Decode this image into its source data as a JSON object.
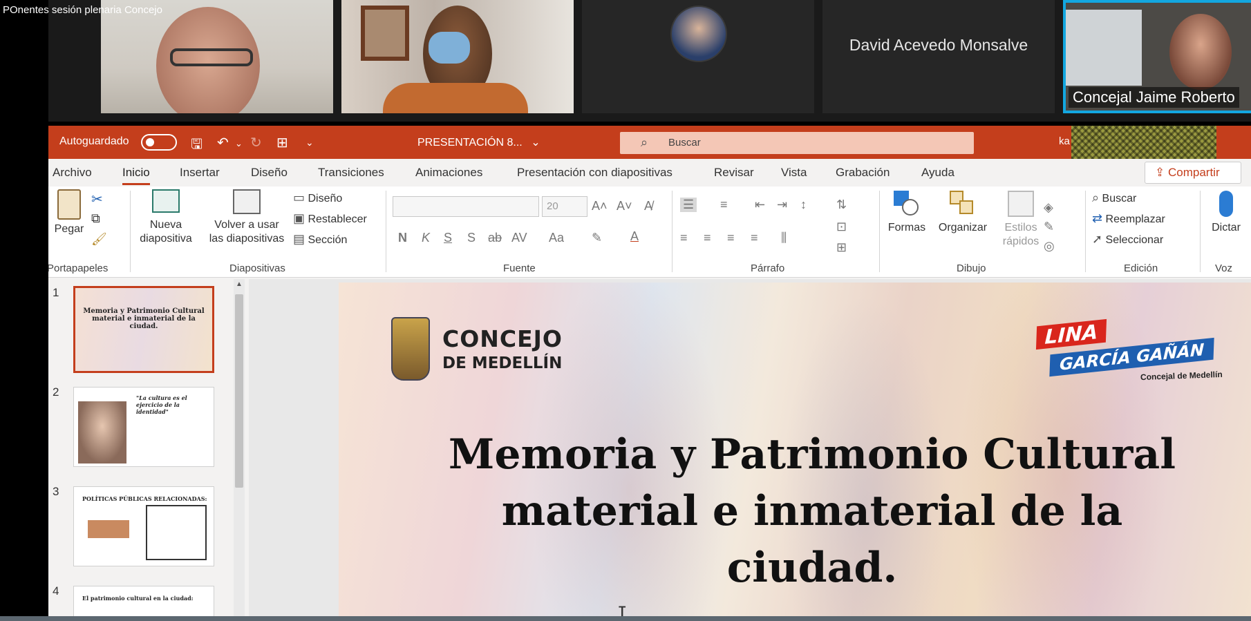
{
  "window": {
    "title": "POnentes sesión plenaria Concejo"
  },
  "participants": [
    {
      "name": ""
    },
    {
      "name": ""
    },
    {
      "name": ""
    },
    {
      "name": "David Acevedo Monsalve"
    },
    {
      "name": "Concejal Jaime Roberto"
    }
  ],
  "titlebar": {
    "autosave_label": "Autoguardado",
    "doc_name": "PRESENTACIÓN 8...",
    "doc_dropdown": "⌄",
    "search_placeholder": "Buscar",
    "user_fragment": "ka"
  },
  "menu": {
    "tabs": [
      "Archivo",
      "Inicio",
      "Insertar",
      "Diseño",
      "Transiciones",
      "Animaciones",
      "Presentación con diapositivas",
      "Revisar",
      "Vista",
      "Grabación",
      "Ayuda"
    ],
    "active": "Inicio",
    "share_label": "Compartir"
  },
  "ribbon": {
    "groups": [
      "Portapapeles",
      "Diapositivas",
      "Fuente",
      "Párrafo",
      "Dibujo",
      "Edición",
      "Voz"
    ],
    "pegar": "Pegar",
    "nueva_diapositiva": [
      "Nueva",
      "diapositiva"
    ],
    "volver": [
      "Volver a usar",
      "las diapositivas"
    ],
    "diseno": "Diseño",
    "restablecer": "Restablecer",
    "seccion": "Sección",
    "font_size": "20",
    "formas": "Formas",
    "organizar": "Organizar",
    "estilos": [
      "Estilos",
      "rápidos"
    ],
    "buscar": "Buscar",
    "reemplazar": "Reemplazar",
    "seleccionar": "Seleccionar",
    "dictar": "Dictar",
    "font_buttons": [
      "N",
      "K",
      "S",
      "S",
      "ab",
      "AV",
      "Aa"
    ]
  },
  "thumbnails": [
    {
      "number": "1",
      "text": "Memoria y Patrimonio Cultural material e inmaterial de la ciudad."
    },
    {
      "number": "2",
      "text": "\"La cultura es el ejercicio de la identidad\""
    },
    {
      "number": "3",
      "text": "POLÍTICAS PÚBLICAS RELACIONADAS:"
    },
    {
      "number": "4",
      "text": "El patrimonio cultural en la ciudad:"
    }
  ],
  "slide": {
    "logo_line1": "CONCEJO",
    "logo_line2": "DE MEDELLÍN",
    "brand_line1": "LINA",
    "brand_line2": "GARCÍA GAÑÁN",
    "brand_sub": "Concejal de Medellín",
    "title_lines": [
      "Memoria y Patrimonio Cultural",
      "material e inmaterial de la",
      "ciudad."
    ]
  },
  "colors": {
    "ppt_accent": "#c43e1c",
    "active_speaker_border": "#13a7e0"
  }
}
